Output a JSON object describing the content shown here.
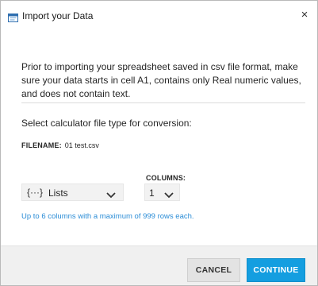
{
  "window": {
    "title": "Import your Data",
    "close_glyph": "×"
  },
  "intro_text": "Prior to importing your spreadsheet saved in csv file format, make sure your data starts in cell A1, contains only Real numeric values, and does not contain text.",
  "select_label": "Select calculator file type for conversion:",
  "filename": {
    "key": "FILENAME:",
    "value": "01 test.csv"
  },
  "file_type": {
    "icon_glyph": "{···}",
    "selected": "Lists"
  },
  "columns": {
    "label": "COLUMNS:",
    "selected": "1"
  },
  "hint": "Up to 6 columns with a maximum of 999 rows each.",
  "buttons": {
    "cancel": "CANCEL",
    "continue": "CONTINUE"
  },
  "colors": {
    "accent": "#149ee0",
    "hint": "#2a8cd6",
    "footer_bg": "#f0f0f0"
  },
  "icons": {
    "app": "app-window-icon",
    "close": "close-icon",
    "dropdown": "chevron-down-icon",
    "list_type": "braces-list-icon"
  }
}
